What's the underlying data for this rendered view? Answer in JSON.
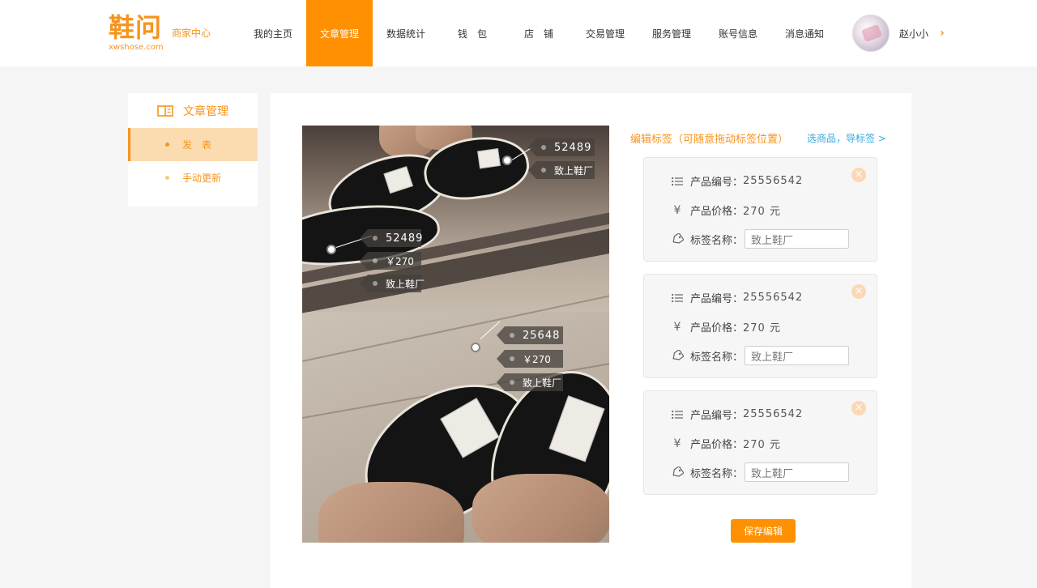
{
  "brand": {
    "logo_text": "鞋问",
    "subtitle": "商家中心",
    "domain": "xwshose.com",
    "accent_color": "#f7941d",
    "nav_active_color": "#fe9001"
  },
  "nav": {
    "items": [
      {
        "label": "我的主页"
      },
      {
        "label": "文章管理",
        "active": true
      },
      {
        "label": "数据统计"
      },
      {
        "label": "钱　包"
      },
      {
        "label": "店　铺"
      },
      {
        "label": "交易管理"
      },
      {
        "label": "服务管理"
      },
      {
        "label": "账号信息"
      },
      {
        "label": "消息通知"
      }
    ]
  },
  "user": {
    "name": "赵小小",
    "avatar_icon": "avatar-photo",
    "menu_icon": "chevron-right-icon"
  },
  "sidebar": {
    "title": "文章管理",
    "title_icon": "book-icon",
    "items": [
      {
        "label": "发　表",
        "active": true
      },
      {
        "label": "手动更新"
      }
    ]
  },
  "photo": {
    "tags": [
      {
        "code": "52489",
        "name": "致上鞋厂"
      },
      {
        "code": "52489",
        "price": "￥270",
        "name": "致上鞋厂"
      },
      {
        "code": "25648",
        "price": "￥270",
        "name": "致上鞋厂"
      }
    ]
  },
  "editor": {
    "title": "编辑标签（可随意拖动标签位置）",
    "pick_link": "选商品，导标签 >",
    "cards": [
      {
        "code_label": "产品编号：",
        "code": "25556542",
        "price_label": "产品价格：",
        "price": "270 元",
        "name_label": "标签名称：",
        "name_value": "致上鞋厂"
      },
      {
        "code_label": "产品编号：",
        "code": "25556542",
        "price_label": "产品价格：",
        "price": "270 元",
        "name_label": "标签名称：",
        "name_value": "致上鞋厂"
      },
      {
        "code_label": "产品编号：",
        "code": "25556542",
        "price_label": "产品价格：",
        "price": "270 元",
        "name_label": "标签名称：",
        "name_value": "致上鞋厂"
      }
    ],
    "save_label": "保存编辑"
  }
}
